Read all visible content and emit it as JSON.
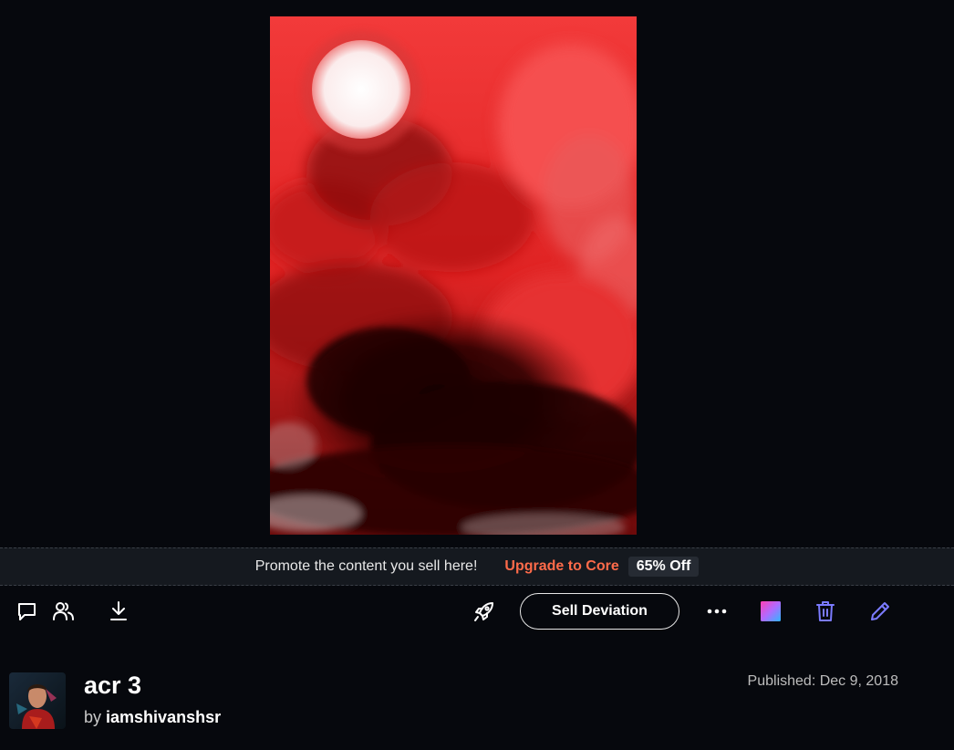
{
  "artwork": {
    "title": "acr 3"
  },
  "promo": {
    "text": "Promote the content you sell here!",
    "link": "Upgrade to Core",
    "badge": "65% Off"
  },
  "actions": {
    "comment_icon": "comment-icon",
    "watchers_icon": "people-icon",
    "download_icon": "download-icon",
    "promote_icon": "rocket-icon",
    "sell_label": "Sell Deviation",
    "more_icon": "more-icon",
    "gradient_icon": "gradient-square-icon",
    "delete_icon": "trash-icon",
    "edit_icon": "pencil-icon",
    "accent_color": "#7b7bff"
  },
  "deviation": {
    "title": "acr 3",
    "by_prefix": "by",
    "author": "iamshivanshsr",
    "published": "Published: Dec 9, 2018"
  }
}
